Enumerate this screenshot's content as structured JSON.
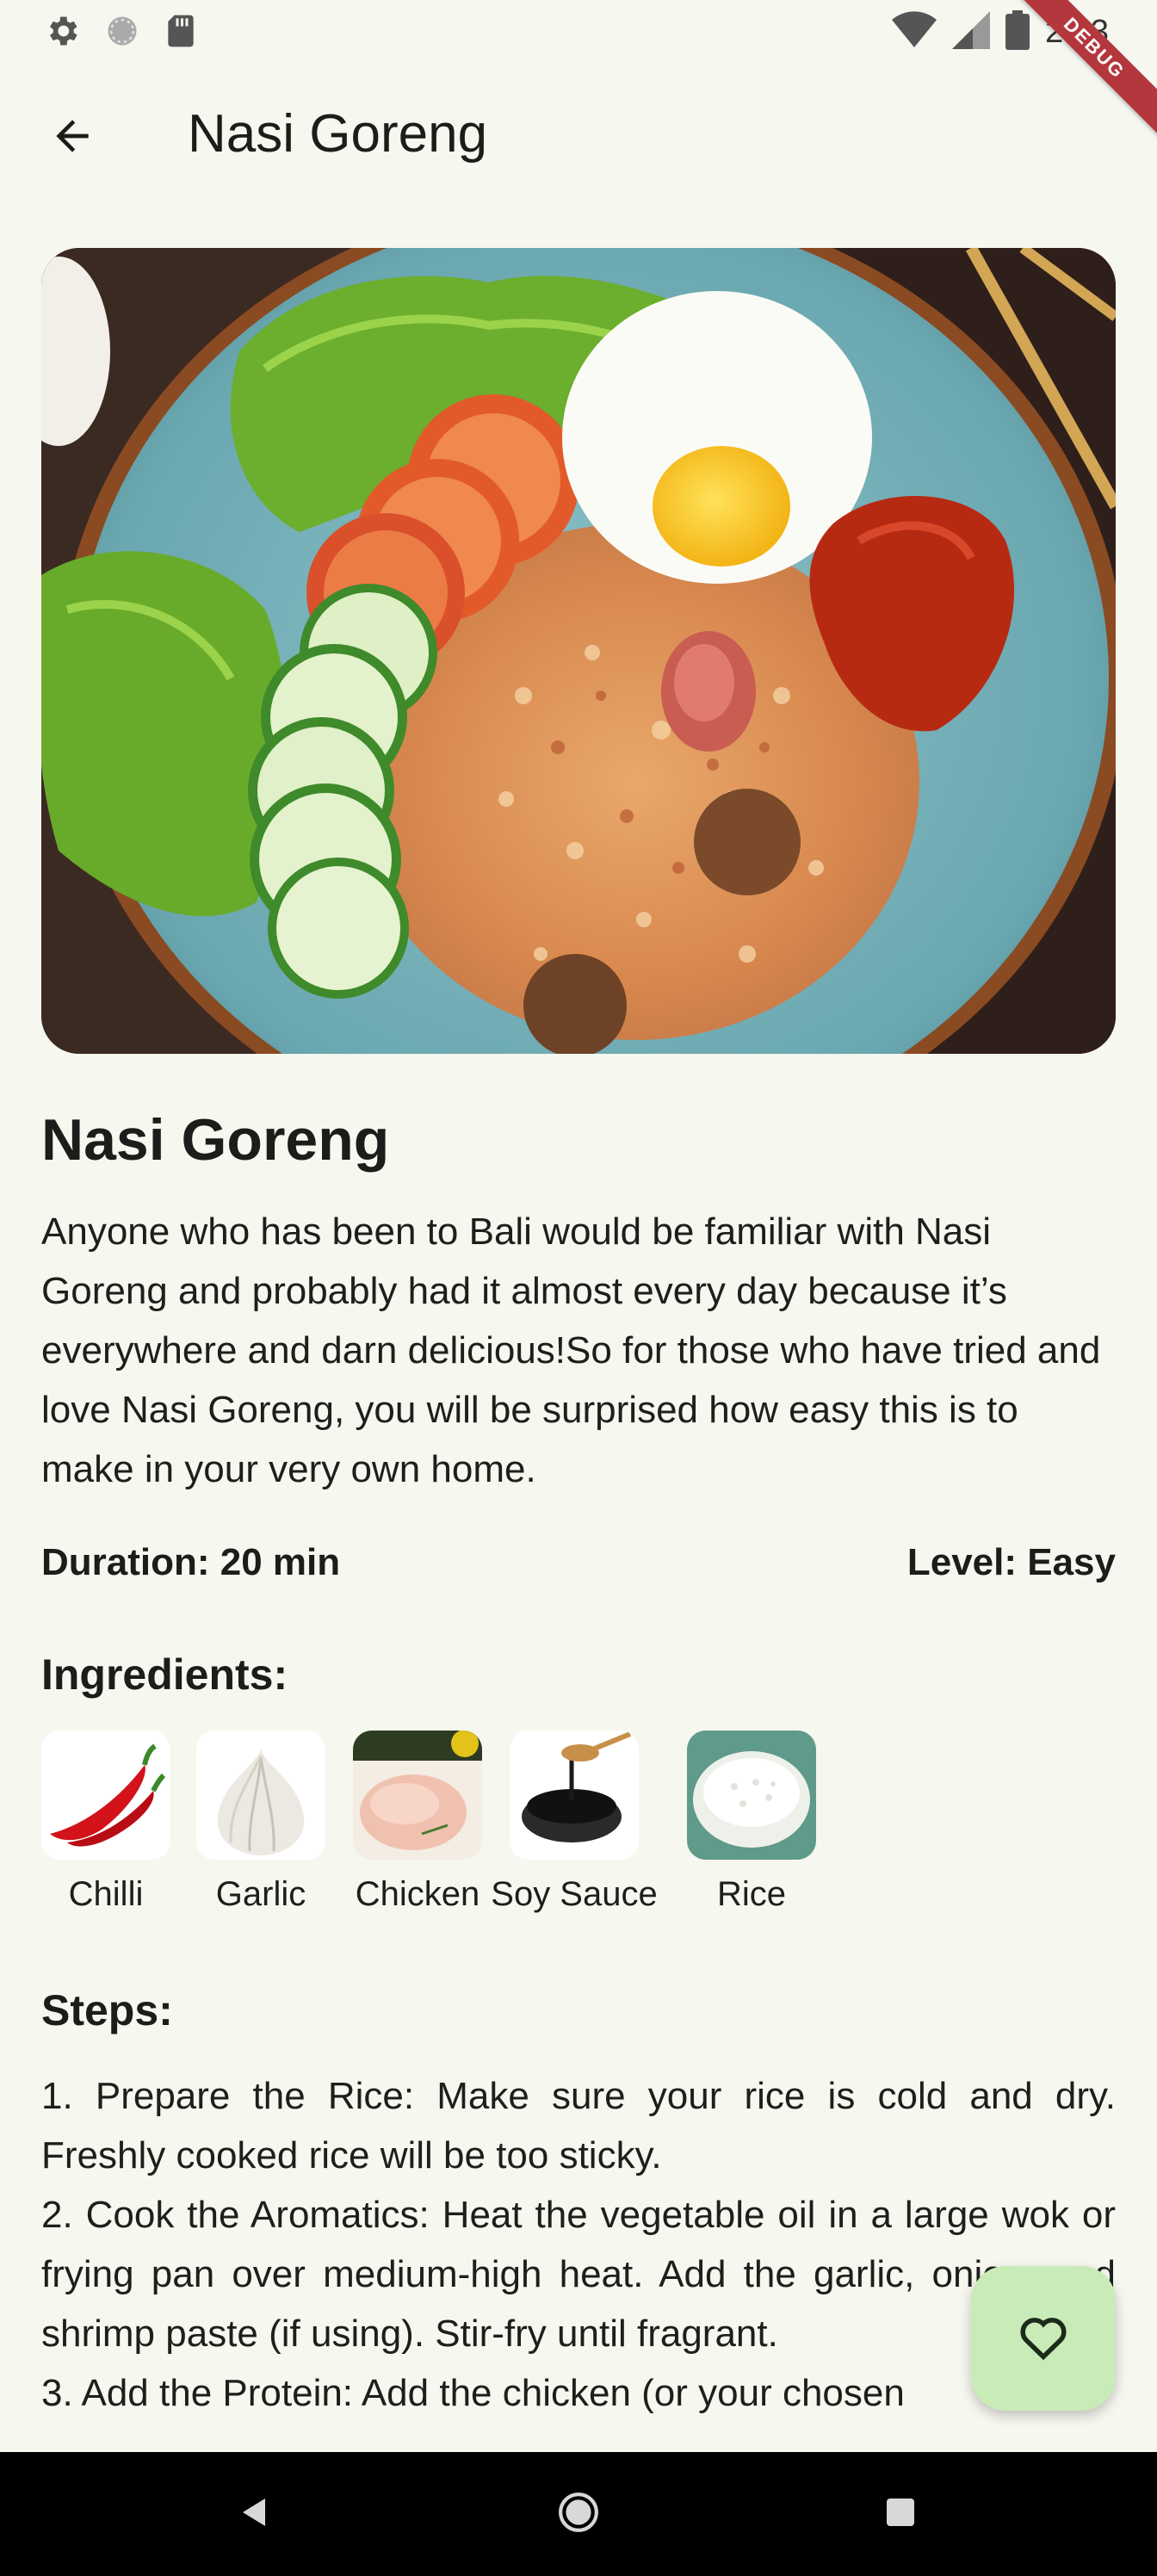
{
  "status_bar": {
    "time": "2:13",
    "icons": [
      "settings-icon",
      "circle-icon",
      "sd-card-icon",
      "wifi-icon",
      "signal-icon",
      "battery-icon"
    ]
  },
  "debug_banner": "DEBUG",
  "app_bar": {
    "title": "Nasi Goreng",
    "back_icon": "arrow-back-icon"
  },
  "recipe": {
    "title": "Nasi Goreng",
    "description": "Anyone who has been to Bali would be familiar with Nasi Goreng and probably had it almost every day because it’s everywhere and darn delicious!So for those who have tried and love Nasi Goreng, you will be surprised how easy this is to make in your very own home.",
    "duration": "Duration: 20 min",
    "level": "Level: Easy",
    "ingredients_heading": "Ingredients:",
    "ingredients": [
      {
        "label": "Chilli"
      },
      {
        "label": "Garlic"
      },
      {
        "label": "Chicken"
      },
      {
        "label": "Soy Sauce"
      },
      {
        "label": "Rice"
      }
    ],
    "steps_heading": "Steps:",
    "steps": [
      "1. Prepare the Rice: Make sure your rice is cold and dry. Freshly cooked rice will be too sticky.",
      "2. Cook the Aromatics: Heat the vegetable oil in a large wok or frying pan over medium-high heat. Add the garlic, onion, and shrimp paste (if using). Stir-fry until fragrant.",
      "3. Add the Protein: Add the chicken (or your chosen"
    ]
  },
  "fab": {
    "icon": "heart-outline-icon"
  },
  "colors": {
    "background": "#f6f7ef",
    "fab": "#c9ebb8",
    "debug": "#b3373d"
  }
}
